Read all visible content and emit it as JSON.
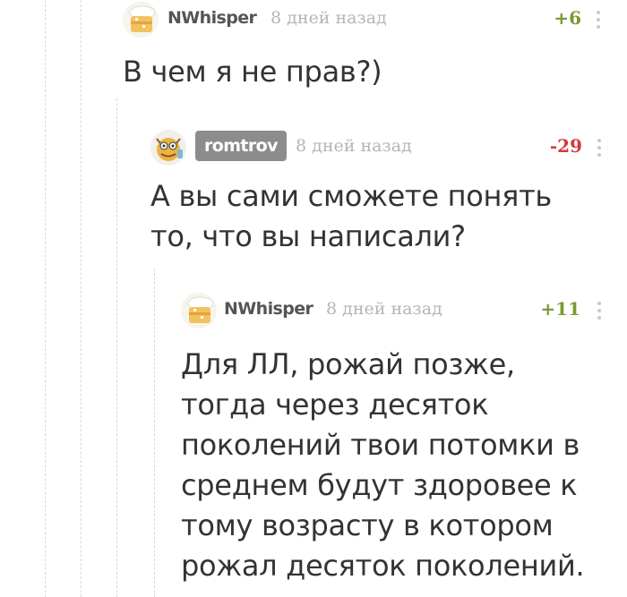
{
  "comments": [
    {
      "author": "NWhisper",
      "avatar_icon": "cake-icon",
      "time": "8 дней назад",
      "rating": "+6",
      "rating_color": "#7a9a33",
      "text": "В чем я не прав?)"
    },
    {
      "author": "romtrov",
      "avatar_icon": "cartoon-character-icon",
      "author_badge_color": "#8c8c8c",
      "time": "8 дней назад",
      "rating": "-29",
      "rating_color": "#d23b3b",
      "text": "А вы сами сможете понять\nто, что вы написали?"
    },
    {
      "author": "NWhisper",
      "avatar_icon": "cake-icon",
      "time": "8 дней назад",
      "rating": "+11",
      "rating_color": "#7a9a33",
      "text": "Для ЛЛ, рожай позже,\nтогда через десяток\nпоколений твои потомки в\nсреднем будут здоровее к\nтому возрасту в котором\nрожал десяток поколений."
    }
  ],
  "more_icon": "vertical-dots-icon"
}
